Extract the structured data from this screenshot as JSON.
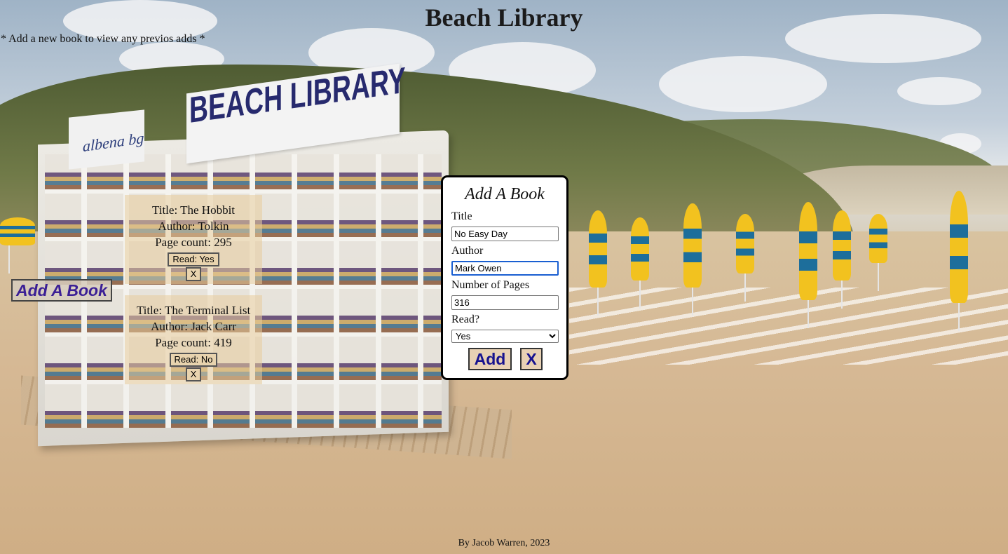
{
  "header": {
    "title": "Beach Library",
    "hint": "* Add a new book to view any previos adds *"
  },
  "background": {
    "sign_main": "BEACH LIBRARY",
    "sign_small": "albena bg"
  },
  "open_add_button": {
    "label": "Add A Book"
  },
  "books": [
    {
      "title_text": "Title: The Hobbit",
      "author_text": "Author: Tolkin",
      "pages_text": "Page count: 295",
      "read_label": "Read: Yes",
      "remove_label": "X"
    },
    {
      "title_text": "Title: The Terminal List",
      "author_text": "Author: Jack Carr",
      "pages_text": "Page count: 419",
      "read_label": "Read: No",
      "remove_label": "X"
    }
  ],
  "modal": {
    "heading": "Add A Book",
    "title_label": "Title",
    "title_value": "No Easy Day",
    "author_label": "Author",
    "author_value": "Mark Owen",
    "pages_label": "Number of Pages",
    "pages_value": "316",
    "read_label": "Read?",
    "read_selected": "Yes",
    "submit_label": "Add",
    "close_label": "X"
  },
  "footer": {
    "credit": "By Jacob Warren, 2023"
  },
  "colors": {
    "accent_text": "#16128f",
    "button_bg": "#e8d1b4",
    "focus_ring": "#1a5fd1"
  }
}
